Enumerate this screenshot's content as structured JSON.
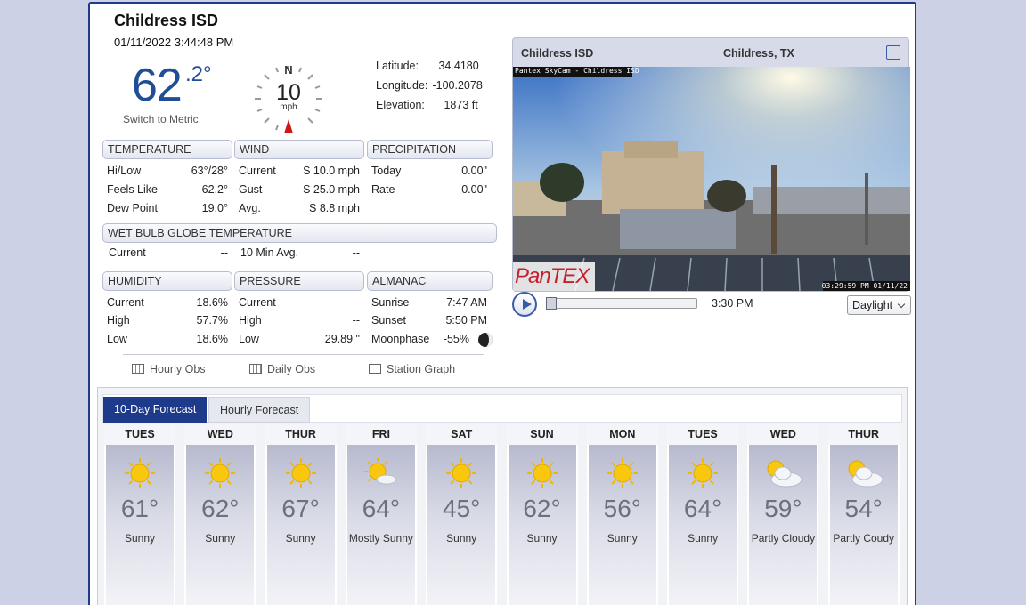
{
  "station": {
    "title": "Childress ISD",
    "datetime": "01/11/2022 3:44:48 PM",
    "temp_whole": "62",
    "temp_fraction": ".2°",
    "switch_units": "Switch to Metric"
  },
  "wind_compass": {
    "direction": "N",
    "speed": "10",
    "unit": "mph"
  },
  "location": {
    "latitude_label": "Latitude:",
    "latitude": "34.4180",
    "longitude_label": "Longitude:",
    "longitude": "-100.2078",
    "elevation_label": "Elevation:",
    "elevation": "1873 ft"
  },
  "temperature": {
    "title": "TEMPERATURE",
    "rows": [
      {
        "label": "Hi/Low",
        "value": "63°/28°"
      },
      {
        "label": "Feels Like",
        "value": "62.2°"
      },
      {
        "label": "Dew Point",
        "value": "19.0°"
      }
    ]
  },
  "wind": {
    "title": "WIND",
    "rows": [
      {
        "label": "Current",
        "value": "S 10.0 mph"
      },
      {
        "label": "Gust",
        "value": "S 25.0 mph"
      },
      {
        "label": "Avg.",
        "value": "S 8.8 mph"
      }
    ]
  },
  "precipitation": {
    "title": "PRECIPITATION",
    "rows": [
      {
        "label": "Today",
        "value": "0.00\""
      },
      {
        "label": "Rate",
        "value": "0.00\""
      }
    ]
  },
  "wet_bulb": {
    "title": "WET BULB GLOBE TEMPERATURE",
    "rows": [
      {
        "label": "Current",
        "value": "--"
      },
      {
        "label": "10 Min Avg.",
        "value": "--"
      }
    ]
  },
  "humidity": {
    "title": "HUMIDITY",
    "rows": [
      {
        "label": "Current",
        "value": "18.6%"
      },
      {
        "label": "High",
        "value": "57.7%"
      },
      {
        "label": "Low",
        "value": "18.6%"
      }
    ]
  },
  "pressure": {
    "title": "PRESSURE",
    "rows": [
      {
        "label": "Current",
        "value": "--"
      },
      {
        "label": "High",
        "value": "--"
      },
      {
        "label": "Low",
        "value": "29.89 \""
      }
    ]
  },
  "almanac": {
    "title": "ALMANAC",
    "rows": [
      {
        "label": "Sunrise",
        "value": "7:47 AM"
      },
      {
        "label": "Sunset",
        "value": "5:50 PM"
      },
      {
        "label": "Moonphase",
        "value": "-55%"
      }
    ]
  },
  "links": {
    "hourly_obs": "Hourly Obs",
    "daily_obs": "Daily Obs",
    "station_graph": "Station Graph"
  },
  "camera": {
    "title": "Childress ISD",
    "location": "Childress, TX",
    "overlay_label": "Pantex SkyCam - Childress ISD",
    "timestamp": "03:29:59 PM 01/11/22",
    "logo_text": "PanTEX",
    "player_time": "3:30 PM",
    "mode": "Daylight"
  },
  "forecast": {
    "tab_active": "10-Day Forecast",
    "tab_inactive": "Hourly Forecast",
    "days": [
      {
        "day": "TUES",
        "temp": "61°",
        "cond": "Sunny",
        "icon": "sun"
      },
      {
        "day": "WED",
        "temp": "62°",
        "cond": "Sunny",
        "icon": "sun"
      },
      {
        "day": "THUR",
        "temp": "67°",
        "cond": "Sunny",
        "icon": "sun"
      },
      {
        "day": "FRI",
        "temp": "64°",
        "cond": "Mostly Sunny",
        "icon": "mostly-sunny"
      },
      {
        "day": "SAT",
        "temp": "45°",
        "cond": "Sunny",
        "icon": "sun"
      },
      {
        "day": "SUN",
        "temp": "62°",
        "cond": "Sunny",
        "icon": "sun"
      },
      {
        "day": "MON",
        "temp": "56°",
        "cond": "Sunny",
        "icon": "sun"
      },
      {
        "day": "TUES",
        "temp": "64°",
        "cond": "Sunny",
        "icon": "sun"
      },
      {
        "day": "WED",
        "temp": "59°",
        "cond": "Partly Cloudy",
        "icon": "partly-cloudy"
      },
      {
        "day": "THUR",
        "temp": "54°",
        "cond": "Partly Coudy",
        "icon": "partly-cloudy"
      }
    ]
  }
}
